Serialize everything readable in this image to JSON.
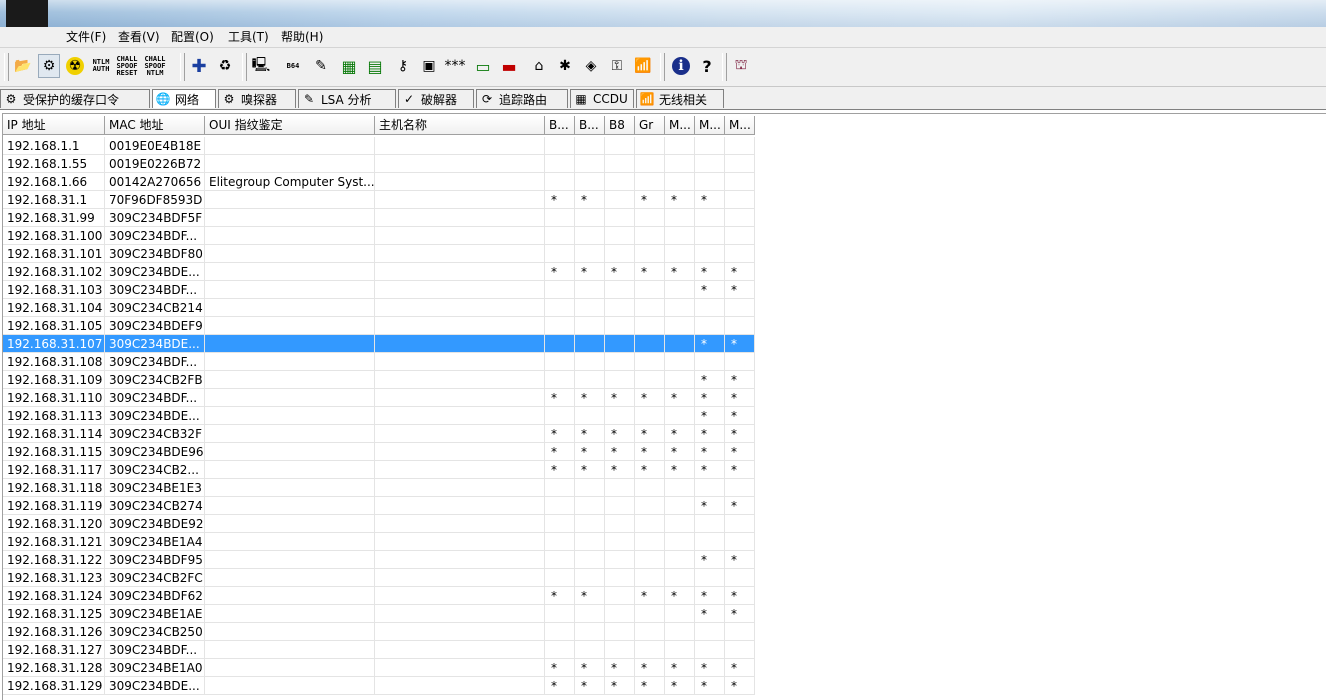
{
  "menu": [
    "文件(F)",
    "查看(V)",
    "配置(O)",
    "工具(T)",
    "帮助(H)"
  ],
  "toolbar_icons": [
    {
      "name": "open-folder-icon",
      "glyph": "📂"
    },
    {
      "name": "network-scan-icon",
      "glyph": "⚙"
    },
    {
      "name": "radiation-icon",
      "glyph": "☢"
    },
    {
      "name": "ntlm-auth-icon",
      "label": "NTLM AUTH"
    },
    {
      "name": "chall-spoof-reset-icon",
      "label": "CHALL SPOOF RESET"
    },
    {
      "name": "chall-spoof-ntlm-icon",
      "label": "CHALL SPOOF NTLM"
    },
    {
      "name": "add-icon",
      "glyph": "✚"
    },
    {
      "name": "recycle-icon",
      "glyph": "♻"
    },
    {
      "name": "scan-computer-icon",
      "glyph": "🖳"
    },
    {
      "name": "base64-icon",
      "label": "B64"
    },
    {
      "name": "wrench-icon",
      "glyph": "✎"
    },
    {
      "name": "hash-monitor-icon",
      "glyph": "▦"
    },
    {
      "name": "vpn-icon",
      "glyph": "▤"
    },
    {
      "name": "key-icon",
      "glyph": "⚷"
    },
    {
      "name": "rdc-icon",
      "glyph": "▣"
    },
    {
      "name": "password-icon",
      "glyph": "***"
    },
    {
      "name": "terminal-icon",
      "glyph": "▭"
    },
    {
      "name": "card-icon",
      "glyph": "▬"
    },
    {
      "name": "house-icon",
      "glyph": "⌂"
    },
    {
      "name": "bug-icon",
      "glyph": "✱"
    },
    {
      "name": "disk-icon",
      "glyph": "◈"
    },
    {
      "name": "lock-icon",
      "glyph": "⚿"
    },
    {
      "name": "wireless-icon",
      "glyph": "📶"
    },
    {
      "name": "info-icon",
      "glyph": "ℹ"
    },
    {
      "name": "help-icon",
      "glyph": "?"
    },
    {
      "name": "exit-icon",
      "glyph": "⛫"
    }
  ],
  "tabs": [
    {
      "label": "受保护的缓存口令",
      "icon": "⚙",
      "name": "tab-protected-cache"
    },
    {
      "label": "网络",
      "icon": "🌐",
      "name": "tab-network"
    },
    {
      "label": "嗅探器",
      "icon": "⚙",
      "name": "tab-sniffer"
    },
    {
      "label": "LSA 分析",
      "icon": "✎",
      "name": "tab-lsa"
    },
    {
      "label": "破解器",
      "icon": "✓",
      "name": "tab-cracker"
    },
    {
      "label": "追踪路由",
      "icon": "⟳",
      "name": "tab-traceroute"
    },
    {
      "label": "CCDU",
      "icon": "▦",
      "name": "tab-ccdu"
    },
    {
      "label": "无线相关",
      "icon": "📶",
      "name": "tab-wireless"
    }
  ],
  "columns": [
    "IP 地址",
    "MAC 地址",
    "OUI 指纹鉴定",
    "主机名称",
    "B...",
    "B...",
    "B8",
    "Gr",
    "M...",
    "M...",
    "M..."
  ],
  "rows": [
    {
      "ip": "192.168.1.1",
      "mac": "0019E0E4B18E",
      "oui": "",
      "host": "",
      "flags": [
        "",
        "",
        "",
        "",
        "",
        "",
        ""
      ]
    },
    {
      "ip": "192.168.1.55",
      "mac": "0019E0226B72",
      "oui": "",
      "host": "",
      "flags": [
        "",
        "",
        "",
        "",
        "",
        "",
        ""
      ]
    },
    {
      "ip": "192.168.1.66",
      "mac": "00142A270656",
      "oui": "Elitegroup Computer Syst...",
      "host": "",
      "flags": [
        "",
        "",
        "",
        "",
        "",
        "",
        ""
      ]
    },
    {
      "ip": "192.168.31.1",
      "mac": "70F96DF8593D",
      "oui": "",
      "host": "",
      "flags": [
        "*",
        "*",
        "",
        "*",
        "*",
        "*",
        ""
      ]
    },
    {
      "ip": "192.168.31.99",
      "mac": "309C234BDF5F",
      "oui": "",
      "host": "",
      "flags": [
        "",
        "",
        "",
        "",
        "",
        "",
        ""
      ]
    },
    {
      "ip": "192.168.31.100",
      "mac": "309C234BDF...",
      "oui": "",
      "host": "",
      "flags": [
        "",
        "",
        "",
        "",
        "",
        "",
        ""
      ]
    },
    {
      "ip": "192.168.31.101",
      "mac": "309C234BDF80",
      "oui": "",
      "host": "",
      "flags": [
        "",
        "",
        "",
        "",
        "",
        "",
        ""
      ]
    },
    {
      "ip": "192.168.31.102",
      "mac": "309C234BDE...",
      "oui": "",
      "host": "",
      "flags": [
        "*",
        "*",
        "*",
        "*",
        "*",
        "*",
        "*"
      ]
    },
    {
      "ip": "192.168.31.103",
      "mac": "309C234BDF...",
      "oui": "",
      "host": "",
      "flags": [
        "",
        "",
        "",
        "",
        "",
        "*",
        "*"
      ]
    },
    {
      "ip": "192.168.31.104",
      "mac": "309C234CB214",
      "oui": "",
      "host": "",
      "flags": [
        "",
        "",
        "",
        "",
        "",
        "",
        ""
      ]
    },
    {
      "ip": "192.168.31.105",
      "mac": "309C234BDEF9",
      "oui": "",
      "host": "",
      "flags": [
        "",
        "",
        "",
        "",
        "",
        "",
        ""
      ]
    },
    {
      "ip": "192.168.31.107",
      "mac": "309C234BDE...",
      "oui": "",
      "host": "",
      "flags": [
        "",
        "",
        "",
        "",
        "",
        "*",
        "*"
      ],
      "selected": true
    },
    {
      "ip": "192.168.31.108",
      "mac": "309C234BDF...",
      "oui": "",
      "host": "",
      "flags": [
        "",
        "",
        "",
        "",
        "",
        "",
        ""
      ]
    },
    {
      "ip": "192.168.31.109",
      "mac": "309C234CB2FB",
      "oui": "",
      "host": "",
      "flags": [
        "",
        "",
        "",
        "",
        "",
        "*",
        "*"
      ]
    },
    {
      "ip": "192.168.31.110",
      "mac": "309C234BDF...",
      "oui": "",
      "host": "",
      "flags": [
        "*",
        "*",
        "*",
        "*",
        "*",
        "*",
        "*"
      ]
    },
    {
      "ip": "192.168.31.113",
      "mac": "309C234BDE...",
      "oui": "",
      "host": "",
      "flags": [
        "",
        "",
        "",
        "",
        "",
        "*",
        "*"
      ]
    },
    {
      "ip": "192.168.31.114",
      "mac": "309C234CB32F",
      "oui": "",
      "host": "",
      "flags": [
        "*",
        "*",
        "*",
        "*",
        "*",
        "*",
        "*"
      ]
    },
    {
      "ip": "192.168.31.115",
      "mac": "309C234BDE96",
      "oui": "",
      "host": "",
      "flags": [
        "*",
        "*",
        "*",
        "*",
        "*",
        "*",
        "*"
      ]
    },
    {
      "ip": "192.168.31.117",
      "mac": "309C234CB2...",
      "oui": "",
      "host": "",
      "flags": [
        "*",
        "*",
        "*",
        "*",
        "*",
        "*",
        "*"
      ]
    },
    {
      "ip": "192.168.31.118",
      "mac": "309C234BE1E3",
      "oui": "",
      "host": "",
      "flags": [
        "",
        "",
        "",
        "",
        "",
        "",
        ""
      ]
    },
    {
      "ip": "192.168.31.119",
      "mac": "309C234CB274",
      "oui": "",
      "host": "",
      "flags": [
        "",
        "",
        "",
        "",
        "",
        "*",
        "*"
      ]
    },
    {
      "ip": "192.168.31.120",
      "mac": "309C234BDE92",
      "oui": "",
      "host": "",
      "flags": [
        "",
        "",
        "",
        "",
        "",
        "",
        ""
      ]
    },
    {
      "ip": "192.168.31.121",
      "mac": "309C234BE1A4",
      "oui": "",
      "host": "",
      "flags": [
        "",
        "",
        "",
        "",
        "",
        "",
        ""
      ]
    },
    {
      "ip": "192.168.31.122",
      "mac": "309C234BDF95",
      "oui": "",
      "host": "",
      "flags": [
        "",
        "",
        "",
        "",
        "",
        "*",
        "*"
      ]
    },
    {
      "ip": "192.168.31.123",
      "mac": "309C234CB2FC",
      "oui": "",
      "host": "",
      "flags": [
        "",
        "",
        "",
        "",
        "",
        "",
        ""
      ]
    },
    {
      "ip": "192.168.31.124",
      "mac": "309C234BDF62",
      "oui": "",
      "host": "",
      "flags": [
        "*",
        "*",
        "",
        "*",
        "*",
        "*",
        "*"
      ]
    },
    {
      "ip": "192.168.31.125",
      "mac": "309C234BE1AE",
      "oui": "",
      "host": "",
      "flags": [
        "",
        "",
        "",
        "",
        "",
        "*",
        "*"
      ]
    },
    {
      "ip": "192.168.31.126",
      "mac": "309C234CB250",
      "oui": "",
      "host": "",
      "flags": [
        "",
        "",
        "",
        "",
        "",
        "",
        ""
      ]
    },
    {
      "ip": "192.168.31.127",
      "mac": "309C234BDF...",
      "oui": "",
      "host": "",
      "flags": [
        "",
        "",
        "",
        "",
        "",
        "",
        ""
      ]
    },
    {
      "ip": "192.168.31.128",
      "mac": "309C234BE1A0",
      "oui": "",
      "host": "",
      "flags": [
        "*",
        "*",
        "*",
        "*",
        "*",
        "*",
        "*"
      ]
    },
    {
      "ip": "192.168.31.129",
      "mac": "309C234BDE...",
      "oui": "",
      "host": "",
      "flags": [
        "*",
        "*",
        "*",
        "*",
        "*",
        "*",
        "*"
      ]
    }
  ],
  "colors": {
    "selection": "#3399ff",
    "grid_line": "#e4e4e4",
    "chrome": "#f0f0f0"
  }
}
